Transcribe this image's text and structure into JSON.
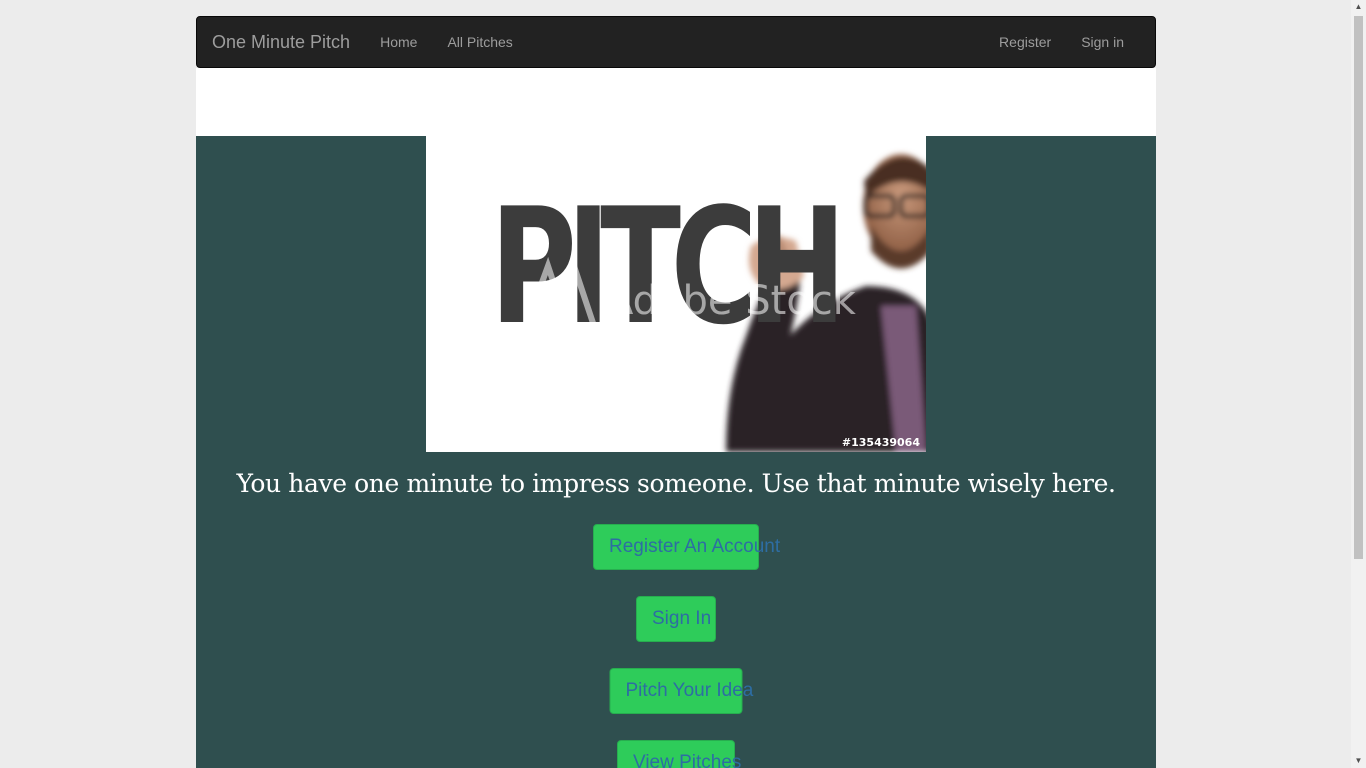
{
  "navbar": {
    "brand": "One Minute Pitch",
    "left_links": [
      "Home",
      "All Pitches"
    ],
    "right_links": [
      "Register",
      "Sign in"
    ]
  },
  "hero": {
    "image": {
      "headline": "PITCH",
      "watermark": "Adobe Stock",
      "stock_id": "#135439064"
    },
    "tagline": "You have one minute to impress someone. Use that minute wisely here.",
    "buttons": {
      "register": "Register An Account",
      "signin": "Sign In",
      "pitch": "Pitch Your Idea",
      "view": "View Pitches"
    }
  },
  "colors": {
    "navbar_bg": "#222222",
    "hero_bg": "#2f4f4f",
    "button_bg": "#2ecc5a",
    "button_text": "#2d6da3"
  },
  "icons": {
    "scroll_up": "triangle-up",
    "scroll_down": "triangle-down"
  }
}
